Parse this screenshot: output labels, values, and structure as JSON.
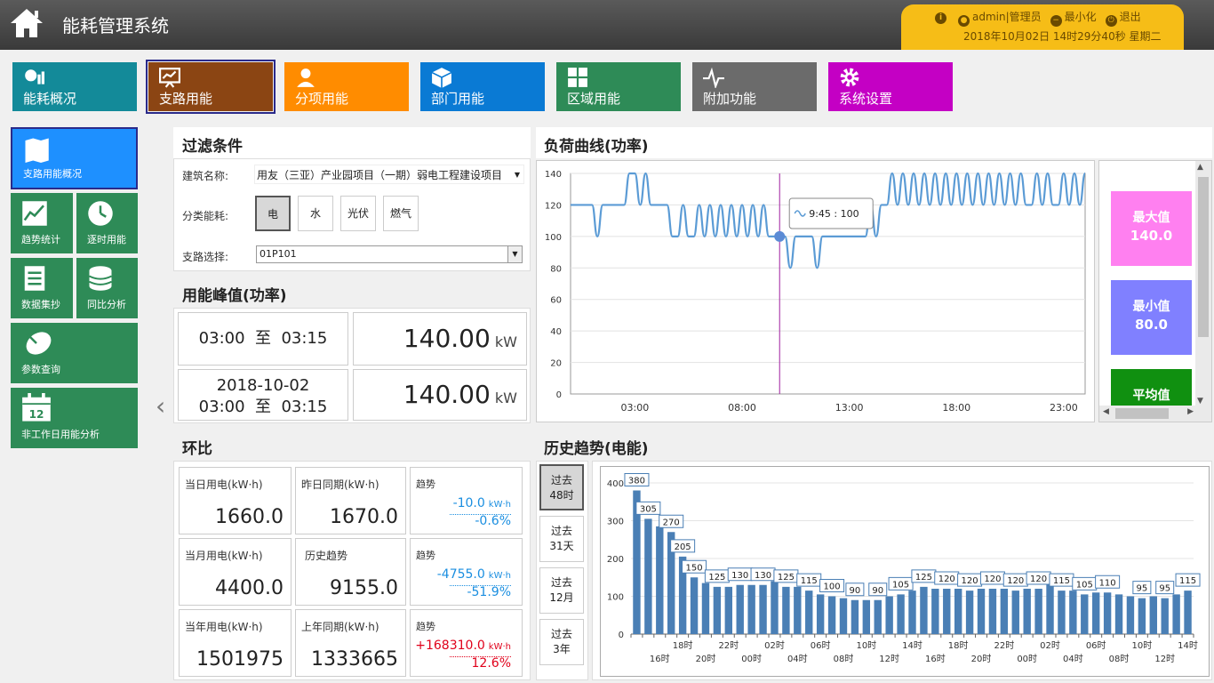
{
  "app": {
    "title": "能耗管理系统"
  },
  "user": {
    "name": "admin",
    "role": "|管理员",
    "minimize_label": "最小化",
    "logout_label": "退出",
    "datetime": "2018年10月02日 14时29分40秒 星期二"
  },
  "nav": {
    "tabs": [
      {
        "label": "能耗概况",
        "color": "#138a99",
        "icon": "energy-overview-icon"
      },
      {
        "label": "支路用能",
        "color": "#8b4513",
        "icon": "presentation-chart-icon"
      },
      {
        "label": "分项用能",
        "color": "#ff8c00",
        "icon": "user-icon"
      },
      {
        "label": "部门用能",
        "color": "#0a7ad4",
        "icon": "cube-icon"
      },
      {
        "label": "区域用能",
        "color": "#2e8b57",
        "icon": "grid-icon"
      },
      {
        "label": "附加功能",
        "color": "#6b6b6b",
        "icon": "pulse-icon"
      },
      {
        "label": "系统设置",
        "color": "#c400c4",
        "icon": "gear-icon"
      }
    ]
  },
  "sidebar": {
    "items": [
      {
        "label": "支路用能概况",
        "icon": "map-icon"
      },
      {
        "label": "趋势统计",
        "icon": "trend-icon"
      },
      {
        "label": "逐时用能",
        "icon": "clock-icon"
      },
      {
        "label": "数据集抄",
        "icon": "document-icon"
      },
      {
        "label": "同比分析",
        "icon": "database-icon"
      },
      {
        "label": "参数查询",
        "icon": "satellite-icon"
      },
      {
        "label": "非工作日用能分析",
        "icon": "calendar-icon"
      }
    ],
    "calendar_day": "12"
  },
  "filter": {
    "title": "过滤条件",
    "building_label": "建筑名称:",
    "building_value": "用友（三亚）产业园项目（一期）弱电工程建设项目",
    "category_label": "分类能耗:",
    "categories": [
      "电",
      "水",
      "光伏",
      "燃气"
    ],
    "branch_label": "支路选择:",
    "branch_value": "01P101"
  },
  "peak": {
    "title": "用能峰值(功率)",
    "row1": {
      "start": "03:00",
      "sep": "至",
      "end": "03:15",
      "value": "140.00",
      "unit": "kW"
    },
    "row2": {
      "date": "2018-10-02",
      "start": "03:00",
      "sep": "至",
      "end": "03:15",
      "value": "140.00",
      "unit": "kW"
    }
  },
  "ratio": {
    "title": "环比",
    "rows": [
      {
        "cur_label": "当日用电(kW·h)",
        "cur_value": "1660.0",
        "prev_label": "昨日同期(kW·h)",
        "prev_value": "1670.0",
        "trend_label": "趋势",
        "trend_value": "-10.0",
        "trend_unit": "kW·h",
        "trend_pct": "-0.6%",
        "color": "#1a8ee0"
      },
      {
        "cur_label": "当月用电(kW·h)",
        "cur_value": "4400.0",
        "prev_label": "历史趋势",
        "prev_value": "9155.0",
        "trend_label": "趋势",
        "trend_value": "-4755.0",
        "trend_unit": "kW·h",
        "trend_pct": "-51.9%",
        "color": "#1a8ee0"
      },
      {
        "cur_label": "当年用电(kW·h)",
        "cur_value": "1501975",
        "prev_label": "上年同期(kW·h)",
        "prev_value": "1333665",
        "trend_label": "趋势",
        "trend_value": "+168310.0",
        "trend_unit": "kW·h",
        "trend_pct": "12.6%",
        "color": "#e0001a"
      }
    ]
  },
  "stats": {
    "cards": [
      {
        "label": "最大值",
        "value": "140.0",
        "color": "#ff80f0"
      },
      {
        "label": "最小值",
        "value": "80.0",
        "color": "#8080ff"
      },
      {
        "label": "平均值",
        "value": "",
        "color": "#109010"
      }
    ]
  },
  "history": {
    "title": "历史趋势(电能)",
    "periods": [
      {
        "l1": "过去",
        "l2": "48时"
      },
      {
        "l1": "过去",
        "l2": "31天"
      },
      {
        "l1": "过去",
        "l2": "12月"
      },
      {
        "l1": "过去",
        "l2": "3年"
      }
    ]
  },
  "chart_data": [
    {
      "type": "line",
      "title": "负荷曲线(功率)",
      "xlabel": "",
      "ylabel": "",
      "ylim": [
        0,
        140
      ],
      "yticks": [
        0,
        20,
        40,
        60,
        80,
        100,
        120,
        140
      ],
      "xticks": [
        "03:00",
        "08:00",
        "13:00",
        "18:00",
        "23:00"
      ],
      "x_range_hours": [
        0,
        24
      ],
      "tooltip": "9:45 : 100",
      "tooltip_x_hour": 9.75,
      "tooltip_y": 100,
      "color": "#5b9bd5",
      "x": [
        0,
        0.25,
        0.5,
        0.75,
        1,
        1.25,
        1.5,
        1.75,
        2,
        2.25,
        2.5,
        2.75,
        3,
        3.25,
        3.5,
        3.75,
        4,
        4.25,
        4.5,
        4.75,
        5,
        5.25,
        5.5,
        5.75,
        6,
        6.25,
        6.5,
        6.75,
        7,
        7.25,
        7.5,
        7.75,
        8,
        8.25,
        8.5,
        8.75,
        9,
        9.25,
        9.5,
        9.75,
        10,
        10.25,
        10.5,
        10.75,
        11,
        11.25,
        11.5,
        11.75,
        12,
        12.25,
        12.5,
        12.75,
        13,
        13.25,
        13.5,
        13.75,
        14,
        14.25,
        14.5,
        14.75,
        15,
        15.25,
        15.5,
        15.75,
        16,
        16.25,
        16.5,
        16.75,
        17,
        17.25,
        17.5,
        17.75,
        18,
        18.25,
        18.5,
        18.75,
        19,
        19.25,
        19.5,
        19.75,
        20,
        20.25,
        20.5,
        20.75,
        21,
        21.25,
        21.5,
        21.75,
        22,
        22.25,
        22.5,
        22.75,
        23,
        23.25,
        23.5,
        23.75,
        24
      ],
      "values": [
        120,
        120,
        120,
        120,
        120,
        100,
        120,
        120,
        120,
        120,
        120,
        140,
        140,
        120,
        140,
        120,
        120,
        120,
        120,
        100,
        100,
        120,
        100,
        100,
        120,
        100,
        120,
        100,
        120,
        100,
        120,
        100,
        120,
        100,
        120,
        100,
        120,
        100,
        100,
        100,
        100,
        80,
        100,
        100,
        100,
        100,
        80,
        100,
        100,
        100,
        100,
        100,
        100,
        100,
        100,
        100,
        120,
        100,
        120,
        120,
        140,
        120,
        140,
        120,
        140,
        120,
        140,
        120,
        140,
        120,
        140,
        120,
        140,
        120,
        140,
        120,
        140,
        120,
        140,
        120,
        140,
        120,
        140,
        120,
        140,
        120,
        120,
        140,
        120,
        140,
        120,
        120,
        140,
        120,
        140,
        120,
        140
      ]
    },
    {
      "type": "bar",
      "title": "历史趋势(电能)",
      "xlabel": "",
      "ylabel": "",
      "ylim": [
        0,
        400
      ],
      "yticks": [
        0,
        100,
        200,
        300,
        400
      ],
      "color": "#4a7fb5",
      "xtick_row1": [
        "18时",
        "22时",
        "02时",
        "06时",
        "10时",
        "14时",
        "18时",
        "22时",
        "02时",
        "06时",
        "10时",
        "14时"
      ],
      "xtick_row2": [
        "16时",
        "20时",
        "00时",
        "04时",
        "08时",
        "12时",
        "16时",
        "20时",
        "00时",
        "04时",
        "08时",
        "12时"
      ],
      "values": [
        380,
        305,
        285,
        270,
        205,
        150,
        135,
        125,
        125,
        130,
        130,
        130,
        140,
        125,
        125,
        115,
        105,
        100,
        95,
        90,
        90,
        90,
        100,
        105,
        115,
        125,
        120,
        120,
        120,
        115,
        120,
        120,
        120,
        115,
        120,
        120,
        135,
        115,
        115,
        105,
        110,
        110,
        105,
        100,
        95,
        100,
        95,
        105,
        115
      ],
      "labels": [
        380,
        305,
        null,
        270,
        205,
        150,
        null,
        125,
        null,
        130,
        null,
        130,
        null,
        125,
        null,
        115,
        null,
        100,
        null,
        90,
        null,
        90,
        null,
        105,
        null,
        125,
        null,
        120,
        null,
        120,
        null,
        120,
        null,
        120,
        null,
        120,
        null,
        115,
        null,
        105,
        null,
        110,
        null,
        null,
        95,
        null,
        95,
        null,
        115
      ]
    }
  ]
}
